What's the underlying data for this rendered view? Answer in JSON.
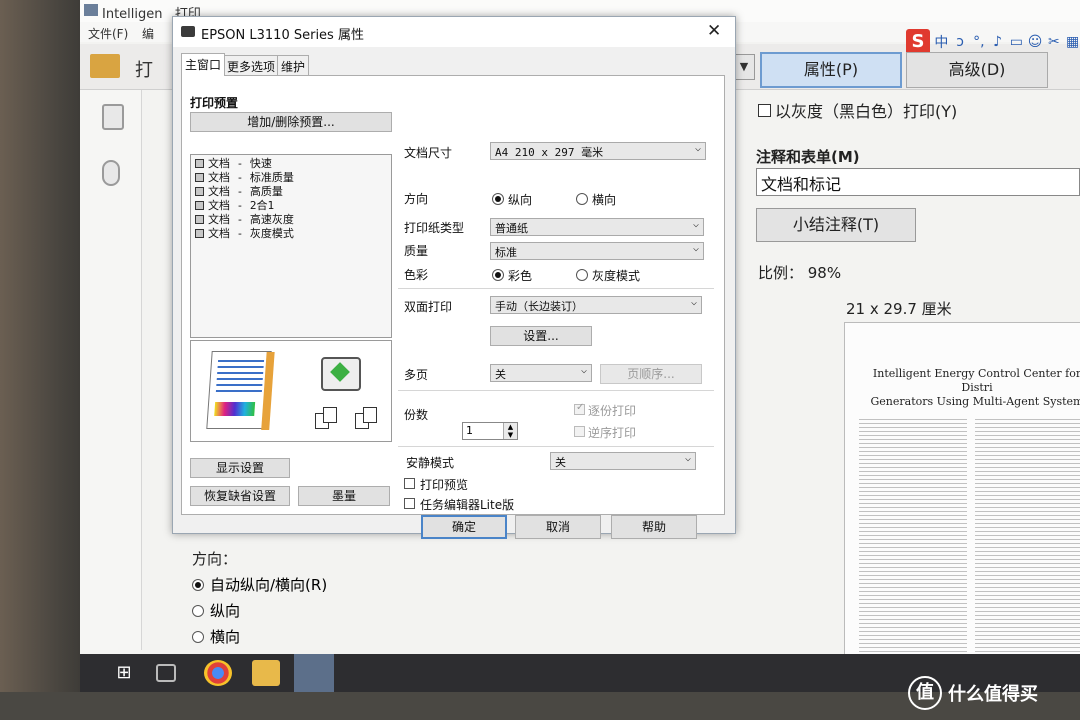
{
  "background_app": {
    "window_title": "Intelligen",
    "window_title_extra": "打印",
    "menu": [
      "文件(F)",
      "编"
    ],
    "toolbar_label": "打",
    "property_button": "属性(P)",
    "advanced_button": "高级(D)",
    "grayscale_option": "以灰度（黑白色）打印(Y)",
    "annotations_title": "注释和表单(M)",
    "annotations_value": "文档和标记",
    "summary_button": "小结注释(T)",
    "scale": "比例：  98%",
    "paper_size": "21 x 29.7 厘米",
    "preview_title_line1": "Intelligent Energy Control Center for Distri",
    "preview_title_line2": "Generators Using Multi-Agent System",
    "orientation_title": "方向：",
    "orientation_options": [
      {
        "label": "自动纵向/横向(R)",
        "selected": true
      },
      {
        "label": "纵向",
        "selected": false
      },
      {
        "label": "横向",
        "selected": false
      }
    ]
  },
  "ime_toolbar": {
    "logo": "S",
    "glyphs": [
      "中",
      "ɔ",
      "°,",
      "🎤",
      "⌨",
      "👤",
      "✂",
      "⊞"
    ]
  },
  "dialog": {
    "title": "EPSON L3110 Series 属性",
    "close": "✕",
    "tabs": [
      "主窗口",
      "更多选项",
      "维护"
    ],
    "print_presets_title": "打印预置",
    "add_remove_presets": "增加/删除预置...",
    "presets": [
      "文档 - 快速",
      "文档 - 标准质量",
      "文档 - 高质量",
      "文档 - 2合1",
      "文档 - 高速灰度",
      "文档 - 灰度模式"
    ],
    "doc_size_label": "文档尺寸",
    "doc_size_value": "A4 210 x 297 毫米",
    "orientation_label": "方向",
    "orientation_portrait": "纵向",
    "orientation_landscape": "横向",
    "paper_type_label": "打印纸类型",
    "paper_type_value": "普通纸",
    "quality_label": "质量",
    "quality_value": "标准",
    "color_label": "色彩",
    "color_option": "彩色",
    "grayscale_option": "灰度模式",
    "duplex_label": "双面打印",
    "duplex_value": "手动（长边装订）",
    "settings_button": "设置...",
    "multipage_label": "多页",
    "multipage_value": "关",
    "page_order_button": "页顺序...",
    "copies_label": "份数",
    "copies_value": "1",
    "collate": "逐份打印",
    "reverse": "逆序打印",
    "quiet_mode_label": "安静模式",
    "quiet_mode_value": "关",
    "print_preview": "打印预览",
    "job_arranger": "任务编辑器Lite版",
    "show_settings": "显示设置",
    "restore_defaults": "恢复缺省设置",
    "ink_levels": "墨量",
    "ok": "确定",
    "cancel": "取消",
    "help": "帮助"
  },
  "watermark": {
    "icon": "值",
    "text": "什么值得买"
  }
}
